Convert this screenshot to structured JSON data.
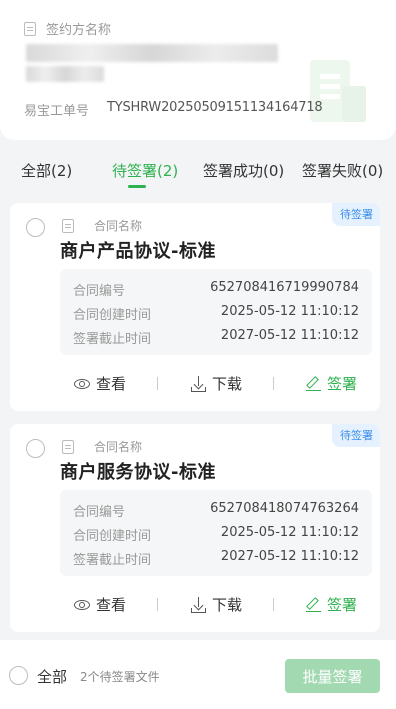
{
  "header": {
    "signer_label": "签约方名称",
    "order_label": "易宝工单号",
    "order_value": "TYSHRW2025050915113416471​8"
  },
  "tabs": [
    {
      "label": "全部(2)"
    },
    {
      "label": "待签署(2)"
    },
    {
      "label": "签署成功(0)"
    },
    {
      "label": "签署失败(0)"
    }
  ],
  "cards": [
    {
      "badge": "待签署",
      "name_label": "合同名称",
      "title": "商户产品协议-标准",
      "rows": [
        {
          "k": "合同编号",
          "v": "652708416719990784"
        },
        {
          "k": "合同创建时间",
          "v": "2025-05-12 11:10:12"
        },
        {
          "k": "签署截止时间",
          "v": "2027-05-12 11:10:12"
        }
      ],
      "actions": {
        "view": "查看",
        "download": "下载",
        "sign": "签署"
      }
    },
    {
      "badge": "待签署",
      "name_label": "合同名称",
      "title": "商户服务协议-标准",
      "rows": [
        {
          "k": "合同编号",
          "v": "652708418074763264"
        },
        {
          "k": "合同创建时间",
          "v": "2025-05-12 11:10:12"
        },
        {
          "k": "签署截止时间",
          "v": "2027-05-12 11:10:12"
        }
      ],
      "actions": {
        "view": "查看",
        "download": "下载",
        "sign": "签署"
      }
    }
  ],
  "footer": {
    "select_all": "全部",
    "pending_count": "2个待签署文件",
    "batch_sign": "批量签署"
  },
  "colors": {
    "accent": "#2fb14f",
    "badge_bg": "#e6f1ff",
    "badge_text": "#3b8ee8",
    "disabled_button": "#a3d9b1"
  }
}
